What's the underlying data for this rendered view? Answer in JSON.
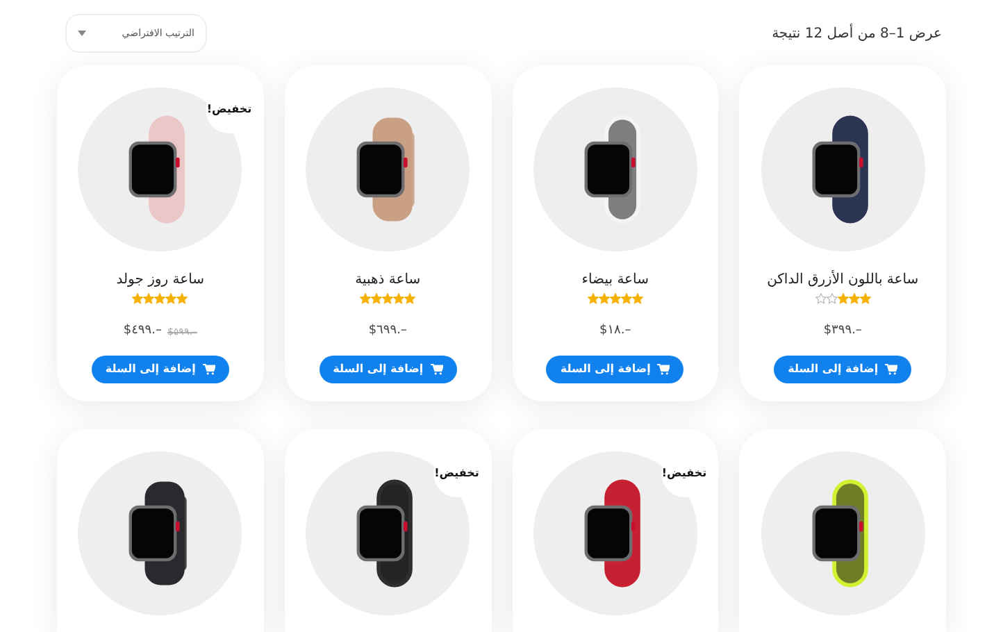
{
  "result_count": "عرض 1–8 من أصل 12 نتيجة",
  "sort": {
    "value": "الترتيب الافتراضي"
  },
  "products": [
    {
      "kind": "sport",
      "color": "#2b3553",
      "sale": false,
      "title": "ساعة باللون الأزرق الداكن",
      "stars": 3,
      "price": "$٣٩٩.–",
      "button": "إضافة إلى السلة"
    },
    {
      "kind": "nike",
      "color": "#f4f4f4",
      "sale": false,
      "title": "ساعة بيضاء",
      "stars": 5,
      "price": "$١٨.–",
      "button": "إضافة إلى السلة"
    },
    {
      "kind": "milanese",
      "color": "#c9a084",
      "sale": false,
      "title": "ساعة ذهبية",
      "stars": 5,
      "price": "$٦٩٩.–",
      "button": "إضافة إلى السلة"
    },
    {
      "kind": "sport",
      "color": "#ecc7c8",
      "sale": true,
      "badge": "تخفيض!",
      "title": "ساعة روز جولد",
      "stars": 5,
      "price": "$٤٩٩.–",
      "old_price": "$٥٩٩.–",
      "button": "إضافة إلى السلة"
    },
    {
      "kind": "nike",
      "color": "#d4f032",
      "sale": false
    },
    {
      "kind": "sport",
      "color": "#c62032",
      "sale": true,
      "badge": "تخفيض!"
    },
    {
      "kind": "nike",
      "color": "#2e2e2e",
      "sale": true,
      "badge": "تخفيض!"
    },
    {
      "kind": "milanese",
      "color": "#2a2a2e",
      "sale": false
    }
  ]
}
